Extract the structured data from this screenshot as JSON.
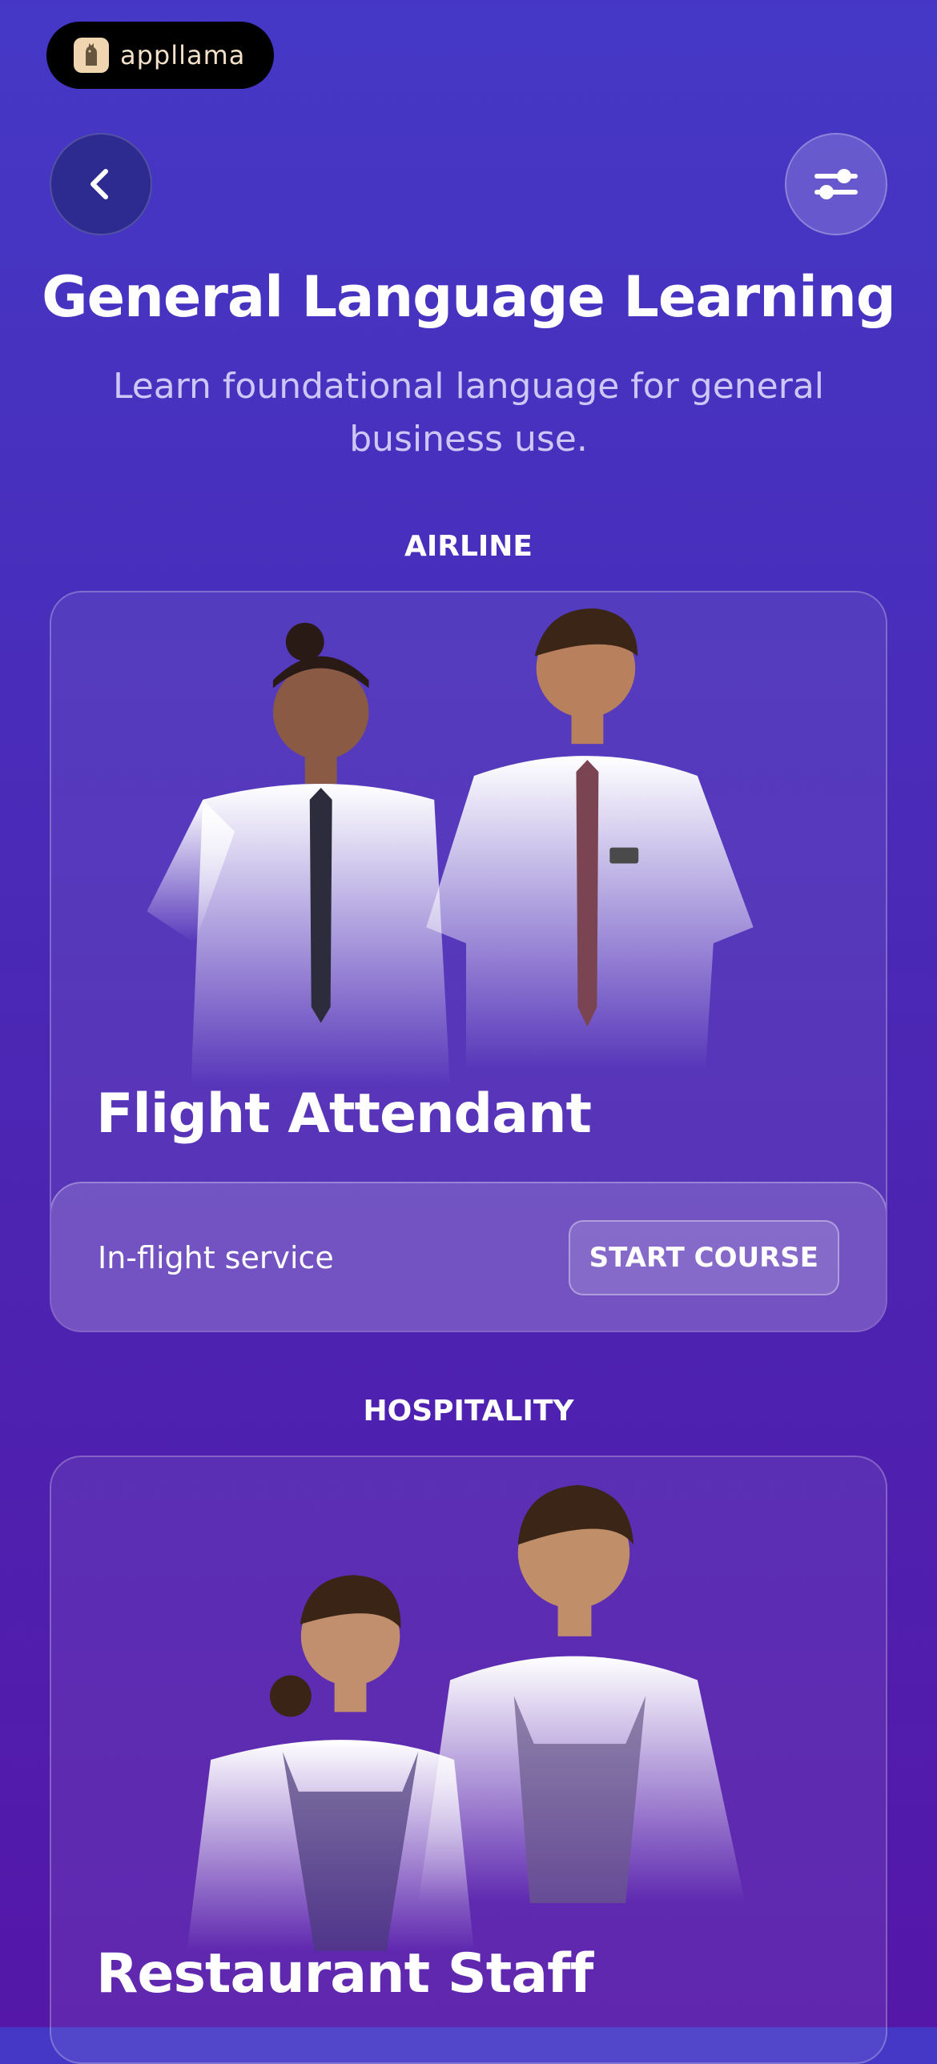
{
  "brand": {
    "name": "appllama",
    "logo_icon": "llama-logo-icon"
  },
  "nav": {
    "back_icon": "chevron-left-icon",
    "filter_icon": "sliders-icon"
  },
  "header": {
    "title": "General Language Learning",
    "subtitle": "Learn foundational language for general business use."
  },
  "sections": [
    {
      "label": "AIRLINE",
      "course": {
        "title": "Flight Attendant",
        "description": "In-flight service",
        "button_label": "START COURSE"
      }
    },
    {
      "label": "HOSPITALITY",
      "course": {
        "title": "Restaurant Staff"
      }
    }
  ],
  "colors": {
    "background_top": "#4538c6",
    "background_bottom": "#5417a8",
    "back_button": "#2d2b8f",
    "brand_text": "#f3e2c9"
  }
}
